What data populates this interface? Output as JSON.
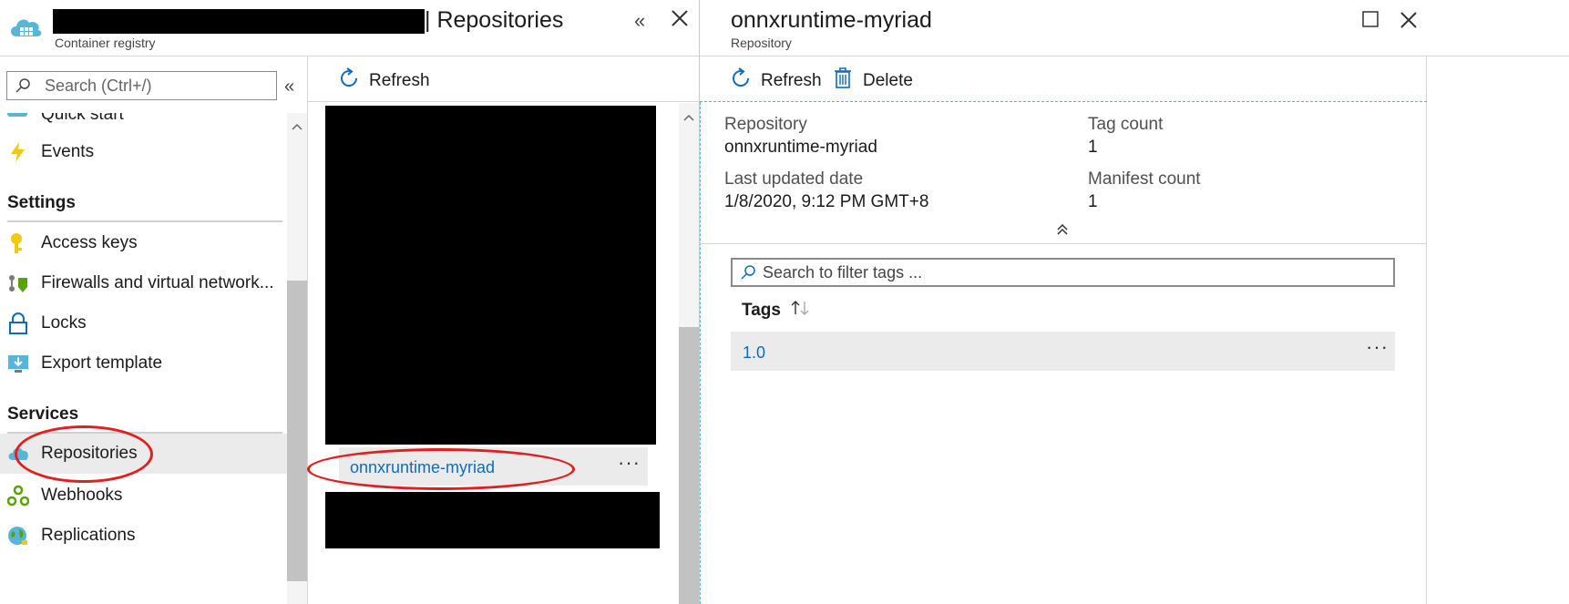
{
  "left_blade": {
    "title": "| Repositories",
    "subtitle": "Container registry",
    "search_placeholder": "Search (Ctrl+/)",
    "partial_item": "Quick start",
    "items_top": [
      {
        "label": "Events",
        "icon": "lightning-icon"
      }
    ],
    "settings_header": "Settings",
    "settings_items": [
      {
        "label": "Access keys",
        "icon": "key-icon"
      },
      {
        "label": "Firewalls and virtual network...",
        "icon": "firewall-network-icon"
      },
      {
        "label": "Locks",
        "icon": "lock-icon"
      },
      {
        "label": "Export template",
        "icon": "export-template-icon"
      }
    ],
    "services_header": "Services",
    "services_items": [
      {
        "label": "Repositories",
        "icon": "repositories-icon",
        "selected": true
      },
      {
        "label": "Webhooks",
        "icon": "webhooks-icon"
      },
      {
        "label": "Replications",
        "icon": "globe-icon"
      }
    ]
  },
  "middle": {
    "refresh_label": "Refresh",
    "selected_repo": "onnxruntime-myriad",
    "more": "···"
  },
  "right_blade": {
    "title": "onnxruntime-myriad",
    "subtitle": "Repository",
    "refresh_label": "Refresh",
    "delete_label": "Delete",
    "repository_label": "Repository",
    "repository_value": "onnxruntime-myriad",
    "tag_count_label": "Tag count",
    "tag_count_value": "1",
    "last_updated_label": "Last updated date",
    "last_updated_value": "1/8/2020, 9:12 PM GMT+8",
    "manifest_count_label": "Manifest count",
    "manifest_count_value": "1",
    "tag_search_placeholder": "Search to filter tags ...",
    "tags_header": "Tags",
    "tags": [
      {
        "name": "1.0",
        "more": "···"
      }
    ]
  },
  "colors": {
    "accent": "#0f6cbd",
    "annotation": "#e02020",
    "selected_bg": "#ebebeb"
  }
}
